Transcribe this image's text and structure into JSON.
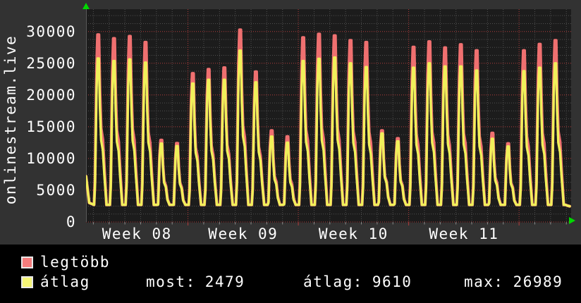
{
  "title": "onlinestream.live",
  "colors": {
    "background_outer": "#323232",
    "background_plot": "#1c1c1c",
    "background_legend": "#000000",
    "grid_minor": "#4f4f4f",
    "grid_major": "#b23c3c",
    "axis_text": "#ffffff",
    "arrow": "#00d800",
    "series_max_line": "#ef7070",
    "series_avg_line": "#f0f05a"
  },
  "legend": {
    "items": [
      {
        "label": "legtöbb",
        "color": "#f47c7c"
      },
      {
        "label": "átlag",
        "color": "#f5f577"
      }
    ]
  },
  "stats": {
    "most": {
      "label": "most:",
      "value": "2479"
    },
    "atlag": {
      "label": "átlag:",
      "value": "9610"
    },
    "max": {
      "label": "max:",
      "value": "26989"
    }
  },
  "chart_data": {
    "type": "line",
    "title": "onlinestream.live",
    "x_labels": [
      "Week 08",
      "Week 09",
      "Week 10",
      "Week 11"
    ],
    "y_ticks": [
      0,
      5000,
      10000,
      15000,
      20000,
      25000,
      30000
    ],
    "ylim": [
      0,
      33500
    ],
    "grid": {
      "minor_y_step": 1250,
      "major_y_step": 5000,
      "minor_x_unit": "day",
      "major_x_unit": "week",
      "days_per_week": 7,
      "first_week_days": 6
    },
    "legend_position": "bottom-left",
    "series": [
      {
        "name": "legtöbb",
        "color": "#ef7070",
        "meaning": "daily maximum viewers"
      },
      {
        "name": "átlag",
        "color": "#f0f05a",
        "meaning": "daily average viewers"
      }
    ],
    "days": [
      {
        "max": 29500,
        "avg": 25750
      },
      {
        "max": 28900,
        "avg": 25350
      },
      {
        "max": 29250,
        "avg": 25600
      },
      {
        "max": 28300,
        "avg": 25100
      },
      {
        "max": 12900,
        "avg": 12350
      },
      {
        "max": 12400,
        "avg": 11950
      },
      {
        "max": 23400,
        "avg": 21800
      },
      {
        "max": 24050,
        "avg": 22400
      },
      {
        "max": 24300,
        "avg": 22400
      },
      {
        "max": 30250,
        "avg": 26989
      },
      {
        "max": 23650,
        "avg": 22000
      },
      {
        "max": 14400,
        "avg": 13450
      },
      {
        "max": 13450,
        "avg": 12500
      },
      {
        "max": 29050,
        "avg": 25350
      },
      {
        "max": 29600,
        "avg": 25700
      },
      {
        "max": 29350,
        "avg": 25900
      },
      {
        "max": 28600,
        "avg": 25000
      },
      {
        "max": 28300,
        "avg": 24400
      },
      {
        "max": 14400,
        "avg": 13950
      },
      {
        "max": 13150,
        "avg": 12700
      },
      {
        "max": 27550,
        "avg": 24300
      },
      {
        "max": 28400,
        "avg": 25000
      },
      {
        "max": 27450,
        "avg": 24500
      },
      {
        "max": 27950,
        "avg": 24500
      },
      {
        "max": 27000,
        "avg": 23850
      },
      {
        "max": 14000,
        "avg": 13100
      },
      {
        "max": 12350,
        "avg": 11900
      },
      {
        "max": 27000,
        "avg": 23750
      },
      {
        "max": 28000,
        "avg": 24300
      },
      {
        "max": 28600,
        "avg": 25000
      }
    ],
    "valley": 2700,
    "start_value": 7200,
    "current_value": 2479,
    "stats": {
      "most": 2479,
      "atlag": 9610,
      "max": 26989
    }
  }
}
